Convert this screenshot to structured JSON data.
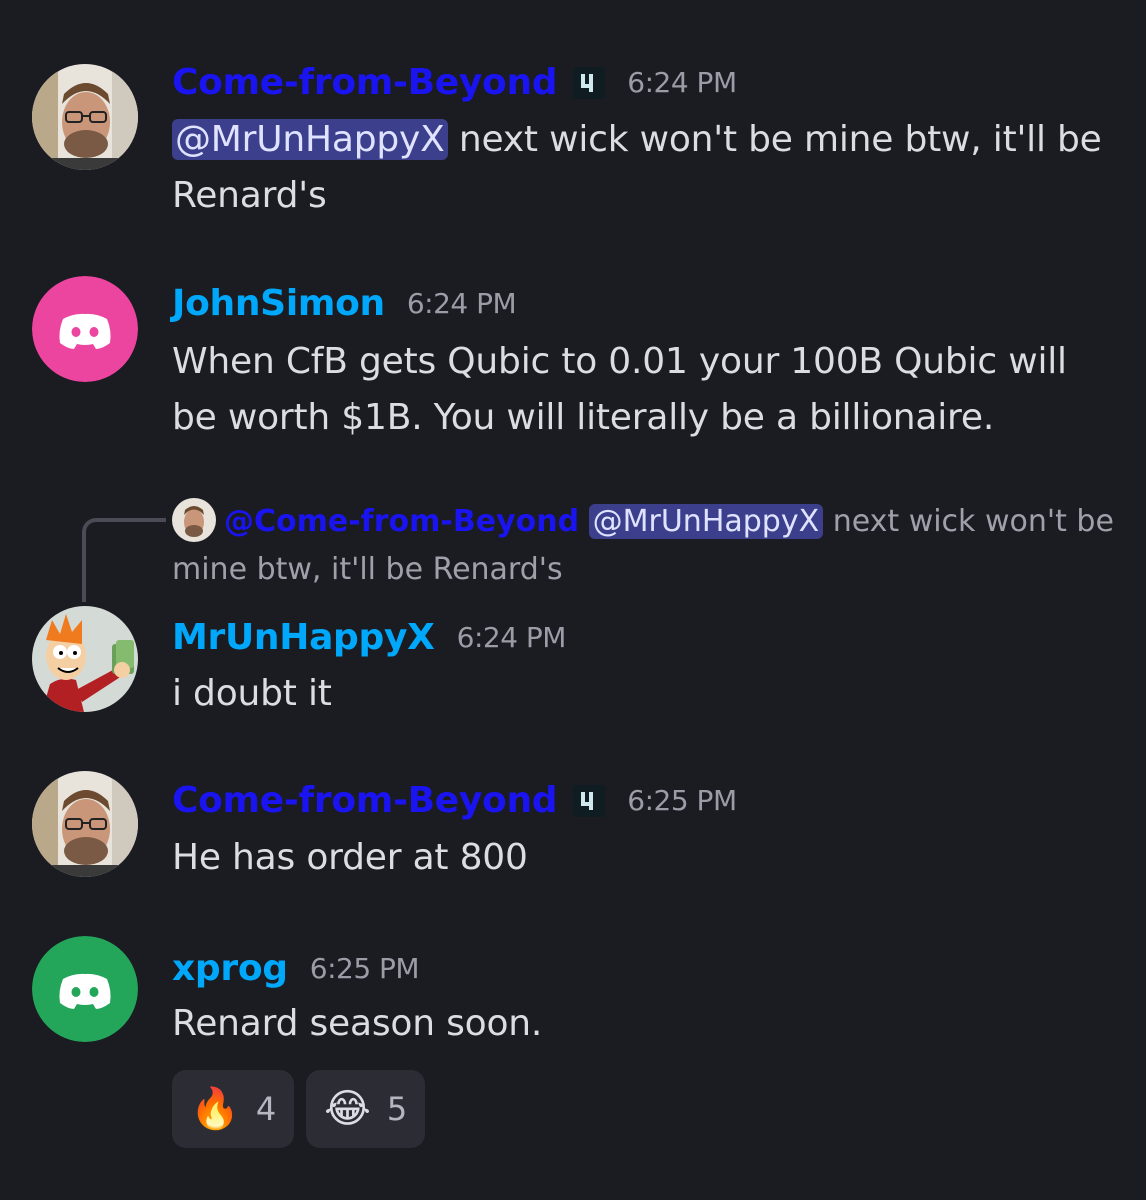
{
  "messages": [
    {
      "author": "Come-from-Beyond",
      "time": "6:24 PM",
      "mention": "@MrUnHappyX",
      "text": " next wick won't be mine btw, it'll be Renard's"
    },
    {
      "author": "JohnSimon",
      "time": "6:24 PM",
      "text": "When CfB gets Qubic to 0.01 your 100B Qubic will be worth $1B. You will literally be a billionaire."
    },
    {
      "reply": {
        "author": "@Come-from-Beyond",
        "mention": "@MrUnHappyX",
        "text": " next wick won't be mine btw, it'll be Renard's"
      },
      "author": "MrUnHappyX",
      "time": "6:24 PM",
      "text": "i doubt it"
    },
    {
      "author": "Come-from-Beyond",
      "time": "6:25 PM",
      "text": "He has order at 800"
    },
    {
      "author": "xprog",
      "time": "6:25 PM",
      "text": "Renard season soon.",
      "reactions": [
        {
          "emoji": "🔥",
          "count": "4"
        },
        {
          "emoji": "😂",
          "count": "5"
        }
      ]
    }
  ],
  "colors": {
    "background": "#1b1b22",
    "username_default": "#00a8fc",
    "username_blue": "#1a14f0",
    "mention_bg": "#3c3f8c",
    "avatar_pink": "#eb459f",
    "avatar_green": "#23a55a"
  },
  "icons": {
    "bot_badge": "chart-bars-badge-icon",
    "default_avatar": "discord-logo-icon"
  }
}
